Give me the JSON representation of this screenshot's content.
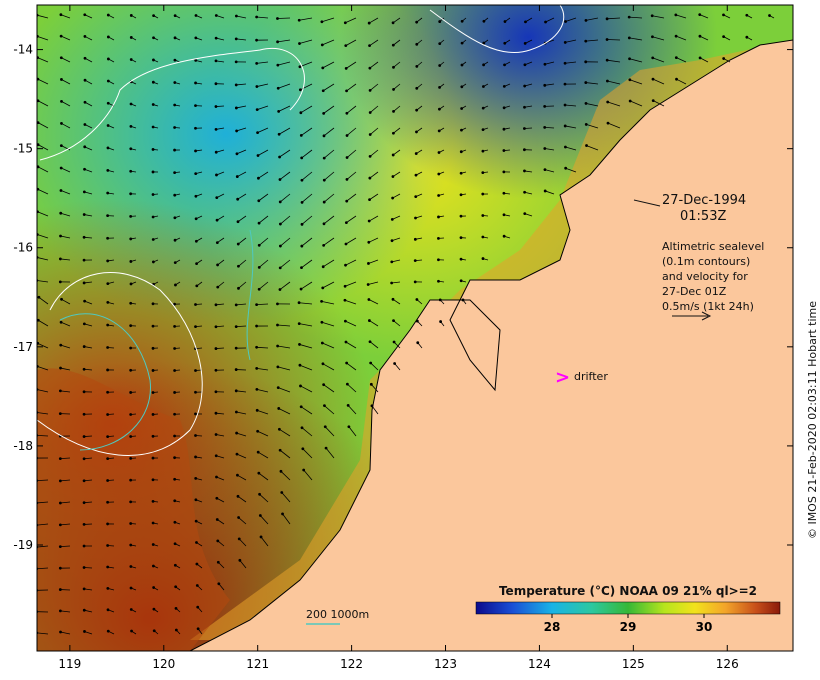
{
  "map": {
    "lon_ticks": [
      "119",
      "120",
      "121",
      "122",
      "123",
      "124",
      "125",
      "126"
    ],
    "lat_ticks": [
      "-14",
      "-15",
      "-16",
      "-17",
      "-18",
      "-19"
    ],
    "lon_values": [
      119,
      120,
      121,
      122,
      123,
      124,
      125,
      126
    ],
    "lat_values": [
      -14,
      -15,
      -16,
      -17,
      -18,
      -19
    ],
    "lon_range": [
      118.65,
      126.7
    ],
    "lat_range": [
      -20.07,
      -13.55
    ]
  },
  "annotations": {
    "date": "27-Dec-1994",
    "time": "01:53Z",
    "altimetric_lines": [
      "Altimetric sealevel",
      "(0.1m contours)",
      "and velocity for",
      "27-Dec 01Z",
      "0.5m/s (1kt 24h)"
    ],
    "drifter_marker": ">",
    "drifter_label": "drifter",
    "bathymetry_label": "200  1000m"
  },
  "colorbar": {
    "title": "Temperature (°C) NOAA 09 21% ql>=2",
    "ticks": [
      "28",
      "29",
      "30"
    ],
    "tick_values": [
      28,
      29,
      30
    ],
    "range": [
      27.0,
      31.0
    ]
  },
  "credit": "© IMOS 21-Feb-2020 02:03:11 Hobart time",
  "colors": {
    "land": "#fbc79c",
    "drifter": "#ff00ff",
    "contour": "#ffffff",
    "bathymetry": "#4fc9c0",
    "arrow": "#000000"
  }
}
